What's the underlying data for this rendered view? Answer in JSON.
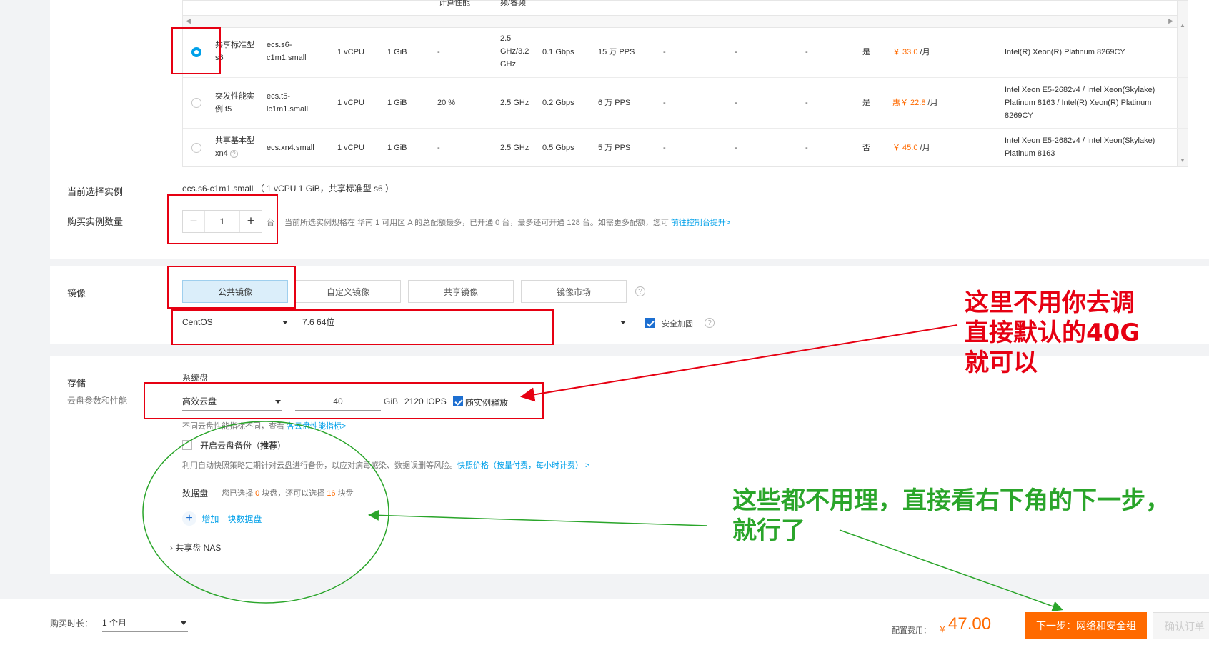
{
  "table": {
    "partial_headers": [
      "计算性能",
      "频/睿频"
    ],
    "rows": [
      {
        "selected": true,
        "family": [
          "共享标准型",
          "s6"
        ],
        "spec": [
          "ecs.s6-",
          "c1m1.small"
        ],
        "vcpu": "1 vCPU",
        "mem": "1 GiB",
        "perf": "-",
        "freq": [
          "2.5",
          "GHz/3.2",
          "GHz"
        ],
        "bandwidth": "0.1 Gbps",
        "pps": "15 万 PPS",
        "c1": "-",
        "c2": "-",
        "c3": "-",
        "ipv6": "是",
        "price": "￥ 33.0",
        "unit": " /月",
        "cpu_model": [
          "Intel(R) Xeon(R) Platinum 8269CY"
        ]
      },
      {
        "selected": false,
        "family": [
          "突发性能实",
          "例 t5"
        ],
        "spec": [
          "ecs.t5-",
          "lc1m1.small"
        ],
        "vcpu": "1 vCPU",
        "mem": "1 GiB",
        "perf": "20 %",
        "freq": [
          "2.5 GHz"
        ],
        "bandwidth": "0.2 Gbps",
        "pps": "6 万 PPS",
        "c1": "-",
        "c2": "-",
        "c3": "-",
        "ipv6": "是",
        "price": "惠￥ 22.8",
        "unit": " /月",
        "cpu_model": [
          "Intel Xeon E5-2682v4 / Intel Xeon(Skylake)",
          "Platinum 8163 / Intel(R) Xeon(R) Platinum",
          "8269CY"
        ]
      },
      {
        "selected": false,
        "family": [
          "共享基本型",
          "xn4"
        ],
        "spec": [
          "ecs.xn4.small"
        ],
        "vcpu": "1 vCPU",
        "mem": "1 GiB",
        "perf": "-",
        "freq": [
          "2.5 GHz"
        ],
        "bandwidth": "0.5 Gbps",
        "pps": "5 万 PPS",
        "c1": "-",
        "c2": "-",
        "c3": "-",
        "ipv6": "否",
        "price": "￥ 45.0",
        "unit": " /月",
        "cpu_model": [
          "Intel Xeon E5-2682v4 / Intel Xeon(Skylake)",
          "Platinum 8163"
        ]
      }
    ]
  },
  "current": {
    "label": "当前选择实例",
    "value": "ecs.s6-c1m1.small （ 1 vCPU 1 GiB，共享标准型 s6 ）"
  },
  "quantity": {
    "label": "购买实例数量",
    "value": "1",
    "unit": "台",
    "hint": "当前所选实例规格在 华南 1 可用区 A 的总配额最多，已开通 0 台，最多还可开通 128 台。如需更多配额，您可",
    "hint_link": "前往控制台提升>"
  },
  "image": {
    "label": "镜像",
    "tabs": [
      "公共镜像",
      "自定义镜像",
      "共享镜像",
      "镜像市场"
    ],
    "os": "CentOS",
    "version": "7.6 64位",
    "security_label": "安全加固"
  },
  "storage": {
    "label": "存储",
    "sublabel": "云盘参数和性能",
    "system_disk_label": "系统盘",
    "disk_type": "高效云盘",
    "size": "40",
    "size_unit": "GiB",
    "iops": "2120 IOPS",
    "release_label": "随实例释放",
    "perf_hint": "不同云盘性能指标不同，查看",
    "perf_link": "各云盘性能指标>",
    "backup_label": "开启云盘备份（",
    "backup_recommend": "推荐",
    "backup_close": "）",
    "backup_desc": "利用自动快照策略定期针对云盘进行备份，以应对病毒感染、数据误删等风险。",
    "backup_link": "快照价格（按量付费，每小时计费） >",
    "data_disk_label": "数据盘",
    "data_disk_hint_1": "您已选择",
    "data_disk_selected": "0",
    "data_disk_hint_2": "块盘，还可以选择",
    "data_disk_remaining": "16",
    "data_disk_hint_3": "块盘",
    "add_disk": "增加一块数据盘",
    "nas_label": "共享盘 NAS"
  },
  "annotations": {
    "red_note_lines": [
      "这里不用你去调",
      "直接默认的40G",
      "就可以"
    ],
    "green_note_lines": [
      "这些都不用理，直接看右下角的下一步，",
      "就行了"
    ]
  },
  "footer": {
    "duration_label": "购买时长：",
    "duration_value": "1 个月",
    "cost_label": "配置费用：",
    "currency": "￥",
    "cost": "47.00",
    "next_button": "下一步：网络和安全组",
    "confirm_button": "确认订单"
  },
  "colors": {
    "accent": "#00a0e9",
    "price": "#ff6a00",
    "annotation_red": "#e60012",
    "annotation_green": "#2aa52a"
  }
}
